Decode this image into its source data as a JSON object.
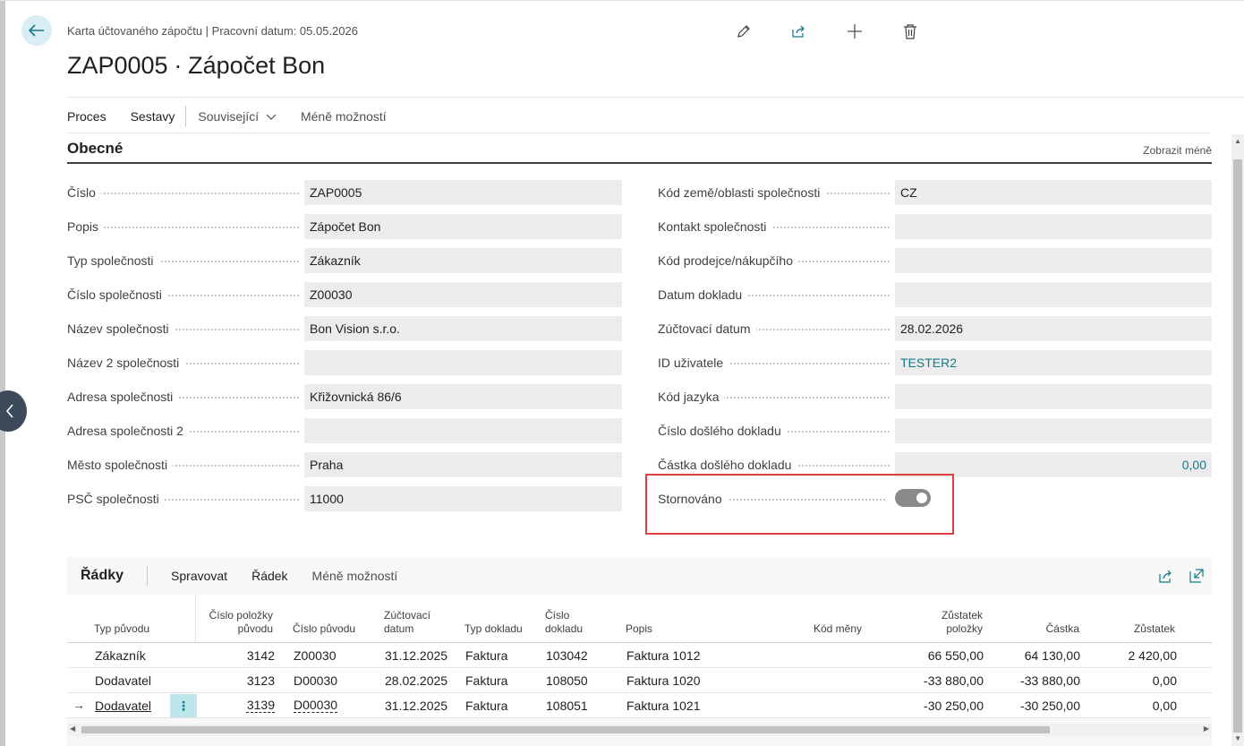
{
  "header": {
    "breadcrumb": "Karta účtovaného zápočtu | Pracovní datum: 05.05.2026",
    "title": "ZAP0005 ∙ Zápočet Bon",
    "actions": [
      "edit-icon",
      "share-icon",
      "new-icon",
      "delete-icon"
    ]
  },
  "menu": {
    "proces": "Proces",
    "sestavy": "Sestavy",
    "souvisejici": "Související",
    "mene_moznosti": "Méně možností"
  },
  "section": {
    "title": "Obecné",
    "show_less": "Zobrazit méně"
  },
  "left_fields": [
    {
      "label": "Číslo",
      "value": "ZAP0005"
    },
    {
      "label": "Popis",
      "value": "Zápočet Bon"
    },
    {
      "label": "Typ společnosti",
      "value": "Zákazník"
    },
    {
      "label": "Číslo společnosti",
      "value": "Z00030"
    },
    {
      "label": "Název společnosti",
      "value": "Bon Vision s.r.o."
    },
    {
      "label": "Název 2 společnosti",
      "value": ""
    },
    {
      "label": "Adresa společnosti",
      "value": "Křižovnická 86/6"
    },
    {
      "label": "Adresa společnosti 2",
      "value": ""
    },
    {
      "label": "Město společnosti",
      "value": "Praha"
    },
    {
      "label": "PSČ společnosti",
      "value": "11000"
    }
  ],
  "right_fields": [
    {
      "label": "Kód země/oblasti společnosti",
      "value": "CZ"
    },
    {
      "label": "Kontakt společnosti",
      "value": ""
    },
    {
      "label": "Kód prodejce/nákupčího",
      "value": ""
    },
    {
      "label": "Datum dokladu",
      "value": ""
    },
    {
      "label": "Zúčtovací datum",
      "value": "28.02.2026"
    },
    {
      "label": "ID uživatele",
      "value": "TESTER2"
    },
    {
      "label": "Kód jazyka",
      "value": ""
    },
    {
      "label": "Číslo došlého dokladu",
      "value": ""
    },
    {
      "label": "Částka došlého dokladu",
      "value": "0,00"
    }
  ],
  "stornovano": {
    "label": "Stornováno",
    "on": true
  },
  "lines": {
    "title": "Řádky",
    "spravovat": "Spravovat",
    "radek": "Řádek",
    "mene_moznosti": "Méně možností",
    "columns": {
      "typ_puvodu": "Typ původu",
      "cislo_polozky_puvodu_1": "Číslo položky",
      "cislo_polozky_puvodu_2": "původu",
      "cislo_puvodu": "Číslo původu",
      "zuctovaci_datum_1": "Zúčtovací",
      "zuctovaci_datum_2": "datum",
      "typ_dokladu": "Typ dokladu",
      "cislo_dokladu_1": "Číslo",
      "cislo_dokladu_2": "dokladu",
      "popis": "Popis",
      "kod_meny": "Kód měny",
      "zustatek_polozky_1": "Zůstatek",
      "zustatek_polozky_2": "položky",
      "castka": "Částka",
      "zustatek": "Zůstatek"
    },
    "rows": [
      {
        "typ": "Zákazník",
        "cislo_polozky": "3142",
        "cislo_puvodu": "Z00030",
        "datum": "31.12.2025",
        "typ_dokladu": "Faktura",
        "cislo_dokladu": "103042",
        "popis": "Faktura 1012",
        "kod_meny": "",
        "zustatek_polozky": "66 550,00",
        "castka": "64 130,00",
        "zustatek": "2 420,00"
      },
      {
        "typ": "Dodavatel",
        "cislo_polozky": "3123",
        "cislo_puvodu": "D00030",
        "datum": "28.02.2025",
        "typ_dokladu": "Faktura",
        "cislo_dokladu": "108050",
        "popis": "Faktura 1020",
        "kod_meny": "",
        "zustatek_polozky": "-33 880,00",
        "castka": "-33 880,00",
        "zustatek": "0,00"
      },
      {
        "typ": "Dodavatel",
        "cislo_polozky": "3139",
        "cislo_puvodu": "D00030",
        "datum": "31.12.2025",
        "typ_dokladu": "Faktura",
        "cislo_dokladu": "108051",
        "popis": "Faktura 1021",
        "kod_meny": "",
        "zustatek_polozky": "-30 250,00",
        "castka": "-30 250,00",
        "zustatek": "0,00"
      }
    ]
  }
}
